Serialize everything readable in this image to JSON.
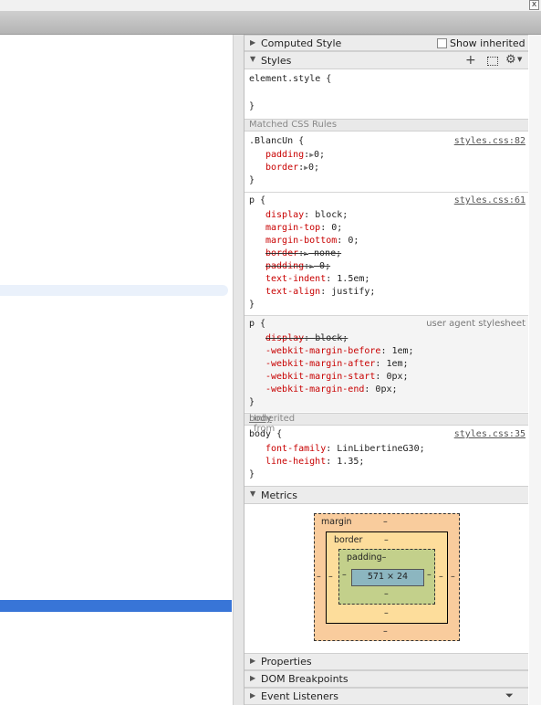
{
  "window": {
    "close_glyph": "x"
  },
  "sidebar": {
    "computed_style": {
      "title": "Computed Style",
      "show_inherited_label": "Show inherited"
    },
    "styles": {
      "title": "Styles",
      "add_icon": "plus-icon",
      "toggle_icon": "element-state-icon",
      "settings_icon": "gear-icon"
    },
    "element_style": {
      "selector": "element.style {",
      "close": "}"
    },
    "matched_header": "Matched CSS Rules",
    "rules": [
      {
        "selector": ".BlancUn {",
        "source": "styles.css:82",
        "declarations": [
          {
            "prop": "padding",
            "val": "0;",
            "arrow": true,
            "overridden": false
          },
          {
            "prop": "border",
            "val": "0;",
            "arrow": true,
            "overridden": false
          }
        ],
        "close": "}"
      },
      {
        "selector": "p {",
        "source": "styles.css:61",
        "declarations": [
          {
            "prop": "display",
            "val": "block;",
            "overridden": false
          },
          {
            "prop": "margin-top",
            "val": "0;",
            "overridden": false
          },
          {
            "prop": "margin-bottom",
            "val": "0;",
            "overridden": false
          },
          {
            "prop": "border",
            "val": "none;",
            "arrow": true,
            "overridden": true
          },
          {
            "prop": "padding",
            "val": "0;",
            "arrow": true,
            "overridden": true
          },
          {
            "prop": "text-indent",
            "val": "1.5em;",
            "overridden": false
          },
          {
            "prop": "text-align",
            "val": "justify;",
            "overridden": false
          }
        ],
        "close": "}"
      },
      {
        "selector": "p {",
        "source": "user agent stylesheet",
        "declarations": [
          {
            "prop": "display",
            "val": "block;",
            "overridden": true
          },
          {
            "prop": "-webkit-margin-before",
            "val": "1em;",
            "overridden": false
          },
          {
            "prop": "-webkit-margin-after",
            "val": "1em;",
            "overridden": false
          },
          {
            "prop": "-webkit-margin-start",
            "val": "0px;",
            "overridden": false
          },
          {
            "prop": "-webkit-margin-end",
            "val": "0px;",
            "overridden": false
          }
        ],
        "close": "}"
      }
    ],
    "inherited_header": {
      "prefix": "Inherited from ",
      "element": "body"
    },
    "inherited_rule": {
      "selector": "body {",
      "source": "styles.css:35",
      "declarations": [
        {
          "prop": "font-family",
          "val": "LinLibertineG30;"
        },
        {
          "prop": "line-height",
          "val": "1.35;"
        }
      ],
      "close": "}"
    },
    "metrics": {
      "title": "Metrics",
      "margin_label": "margin",
      "border_label": "border",
      "padding_label": "padding",
      "content_size": "571 × 24",
      "dash": "–"
    },
    "properties": {
      "title": "Properties"
    },
    "dom_breakpoints": {
      "title": "DOM Breakpoints"
    },
    "event_listeners": {
      "title": "Event Listeners",
      "filter_icon": "filter-icon"
    }
  },
  "colors": {
    "selection": "#3875d7",
    "hover_row": "#eaf1fb",
    "property": "#c80000",
    "margin_box": "#f9cc9d",
    "border_box": "#fddd9b",
    "padding_box": "#c3d08b",
    "content_box": "#8cb6c0"
  }
}
